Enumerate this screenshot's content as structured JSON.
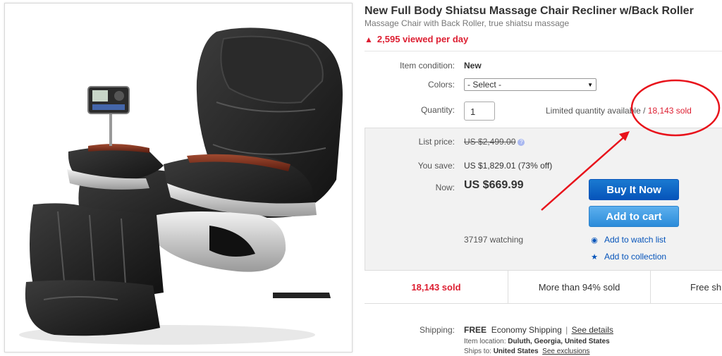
{
  "product": {
    "title": "New Full Body Shiatsu Massage Chair Recliner w/Back Roller",
    "subtitle": "Massage Chair with Back Roller, true shiatsu massage",
    "views": "2,595 viewed per day"
  },
  "details": {
    "condition_label": "Item condition:",
    "condition_value": "New",
    "colors_label": "Colors:",
    "colors_selected": "- Select -",
    "quantity_label": "Quantity:",
    "quantity_value": "1",
    "limited_text": "Limited quantity available /",
    "sold_text": "18,143 sold"
  },
  "price": {
    "list_label": "List price:",
    "list_value": "US $2,499.00",
    "save_label": "You save:",
    "save_value": "US $1,829.01 (73% off)",
    "now_label": "Now:",
    "now_value": "US $669.99",
    "buy_now": "Buy It Now",
    "add_to_cart": "Add to cart",
    "watching": "37197 watching",
    "watch_list": "Add to watch list",
    "collection": "Add to collection"
  },
  "stats": {
    "sold": "18,143 sold",
    "percent_sold": "More than 94% sold",
    "free_shipping": "Free sh"
  },
  "shipping": {
    "label": "Shipping:",
    "free": "FREE",
    "method": "Economy Shipping",
    "see_details": "See details",
    "location_label": "Item location:",
    "location_value": "Duluth, Georgia, United States",
    "ships_label": "Ships to:",
    "ships_value": "United States",
    "see_exclusions": "See exclusions"
  },
  "colors": {
    "accent_red": "#dd1e31",
    "link_blue": "#0654ba",
    "buy_blue": "#0654ba",
    "cart_blue": "#3b98e3",
    "annotation_red": "#e8121b"
  }
}
